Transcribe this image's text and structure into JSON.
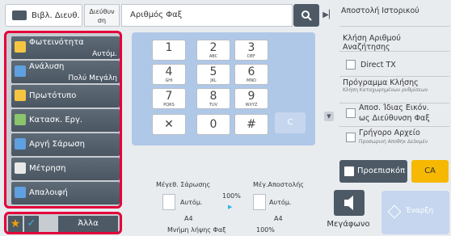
{
  "header": {
    "address_book": "Βιβλ. Διευθ.",
    "address_line1": "Διεύθυν",
    "address_line2": "ση",
    "fax_number": "Αριθμός Φαξ"
  },
  "left_menu": [
    {
      "label": "Φωτεινότητα",
      "sub": "Αυτόμ.",
      "icon_color": "#f5c542"
    },
    {
      "label": "Ανάλυση",
      "sub": "Πολύ Μεγάλη",
      "icon_color": "#5fa0e0"
    },
    {
      "label": "Πρωτότυπο",
      "sub": "",
      "icon_color": "#f5c542"
    },
    {
      "label": "Κατασκ. Εργ.",
      "sub": "",
      "icon_color": "#8ac46d"
    },
    {
      "label": "Αργή Σάρωση",
      "sub": "",
      "icon_color": "#5fa0e0"
    },
    {
      "label": "Μέτρηση",
      "sub": "",
      "icon_color": "#e8e8e8"
    },
    {
      "label": "Απαλοιφή",
      "sub": "",
      "icon_color": "#5fa0e0"
    }
  ],
  "bottom_bar": {
    "more": "Άλλα",
    "star_glyph": "★",
    "check_glyph": "✓"
  },
  "keypad": {
    "keys": [
      {
        "digit": "1",
        "letters": ""
      },
      {
        "digit": "2",
        "letters": "ABC"
      },
      {
        "digit": "3",
        "letters": "DEF"
      },
      {
        "digit": "4",
        "letters": "GHI"
      },
      {
        "digit": "5",
        "letters": "JKL"
      },
      {
        "digit": "6",
        "letters": "MNO"
      },
      {
        "digit": "7",
        "letters": "PQRS"
      },
      {
        "digit": "8",
        "letters": "TUV"
      },
      {
        "digit": "9",
        "letters": "WXYZ"
      }
    ],
    "pause": "✕",
    "zero": "0",
    "hash": "#",
    "clear": "C"
  },
  "status": {
    "scan_size_label": "Μέγεθ. Σάρωσης",
    "send_size_label": "Μέγ.Αποστολής",
    "scan_mode": "Αυτόμ.",
    "send_mode": "Αυτόμ.",
    "scan_paper": "A4",
    "send_paper": "A4",
    "ratio": "100%",
    "memory_label": "Μνήμη λήψης Φαξ",
    "memory_value": "100%"
  },
  "right_panel": {
    "send_history": "Αποστολή Ιστορικού",
    "search_number": "Κλήση Αριθμού Αναζήτησης",
    "direct_tx": "Direct TX",
    "program_call": "Πρόγραμμα Κλήσης",
    "program_call_sub": "Κλήση Καταχωρημένων ρυθμίσεων",
    "same_image_1": "Αποσ. Ίδιας Εικόν.",
    "same_image_2": "ως Διεύθυνση Φαξ",
    "quick_file": "Γρήγορο Αρχείο",
    "quick_file_sub": "Προσωρινή Αποθήκ Δεδομέν"
  },
  "buttons": {
    "preview": "Προεπισκόπ",
    "ca": "CA",
    "speaker": "Μεγάφωνο",
    "start": "Έναρξη"
  },
  "colors": {
    "accent_red": "#e3003a",
    "panel_dark": "#4d5a66",
    "keypad_bg": "#b0c8e8",
    "ca_yellow": "#f6b800"
  }
}
